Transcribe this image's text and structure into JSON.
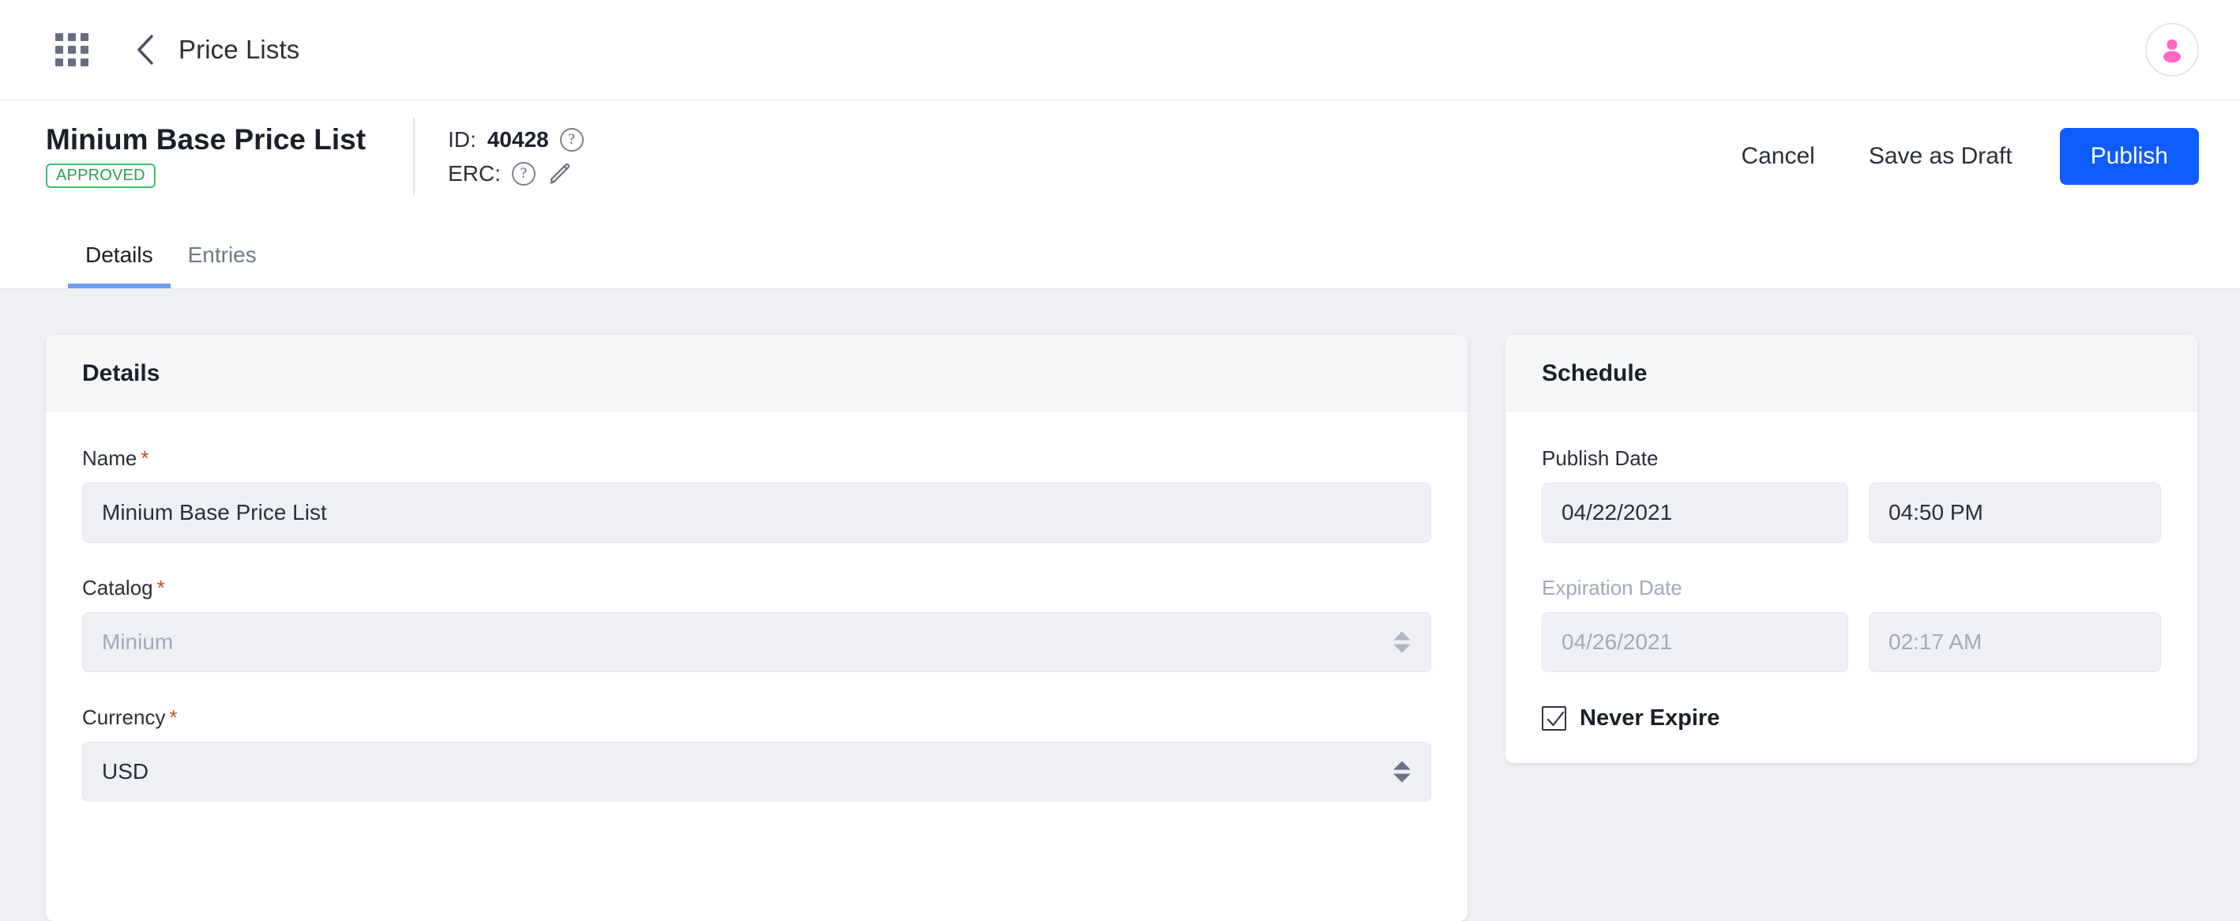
{
  "topbar": {
    "apps_icon": "grid-apps-icon",
    "back_icon": "chevron-left-icon",
    "breadcrumb_title": "Price Lists",
    "avatar_icon": "user-avatar-icon",
    "avatar_color": "#FF69C4"
  },
  "header": {
    "entity_title": "Minium Base Price List",
    "status_badge": "APPROVED",
    "status_color": "#2b9e55",
    "id_label": "ID:",
    "id_value": "40428",
    "id_help_icon": "question-circle-icon",
    "erc_label": "ERC:",
    "erc_value": "",
    "erc_help_icon": "question-circle-icon",
    "erc_edit_icon": "pencil-edit-icon",
    "actions": {
      "cancel": "Cancel",
      "save_as_draft": "Save as Draft",
      "publish": "Publish",
      "publish_color": "#0d5cfb"
    }
  },
  "tabs": [
    {
      "label": "Details",
      "active": true
    },
    {
      "label": "Entries",
      "active": false
    }
  ],
  "details_card": {
    "title": "Details",
    "fields": {
      "name": {
        "label": "Name",
        "required": true,
        "value": "Minium Base Price List",
        "disabled": false
      },
      "catalog": {
        "label": "Catalog",
        "required": true,
        "value": "Minium",
        "disabled": true,
        "control": "select"
      },
      "currency": {
        "label": "Currency",
        "required": true,
        "value": "USD",
        "disabled": false,
        "control": "select"
      }
    }
  },
  "schedule_card": {
    "title": "Schedule",
    "publish_date": {
      "label": "Publish Date",
      "date": "04/22/2021",
      "time": "04:50 PM",
      "disabled": false
    },
    "expiration_date": {
      "label": "Expiration Date",
      "date": "04/26/2021",
      "time": "02:17 AM",
      "disabled": true
    },
    "never_expire": {
      "label": "Never Expire",
      "checked": true,
      "icon": "checkmark-icon"
    }
  }
}
